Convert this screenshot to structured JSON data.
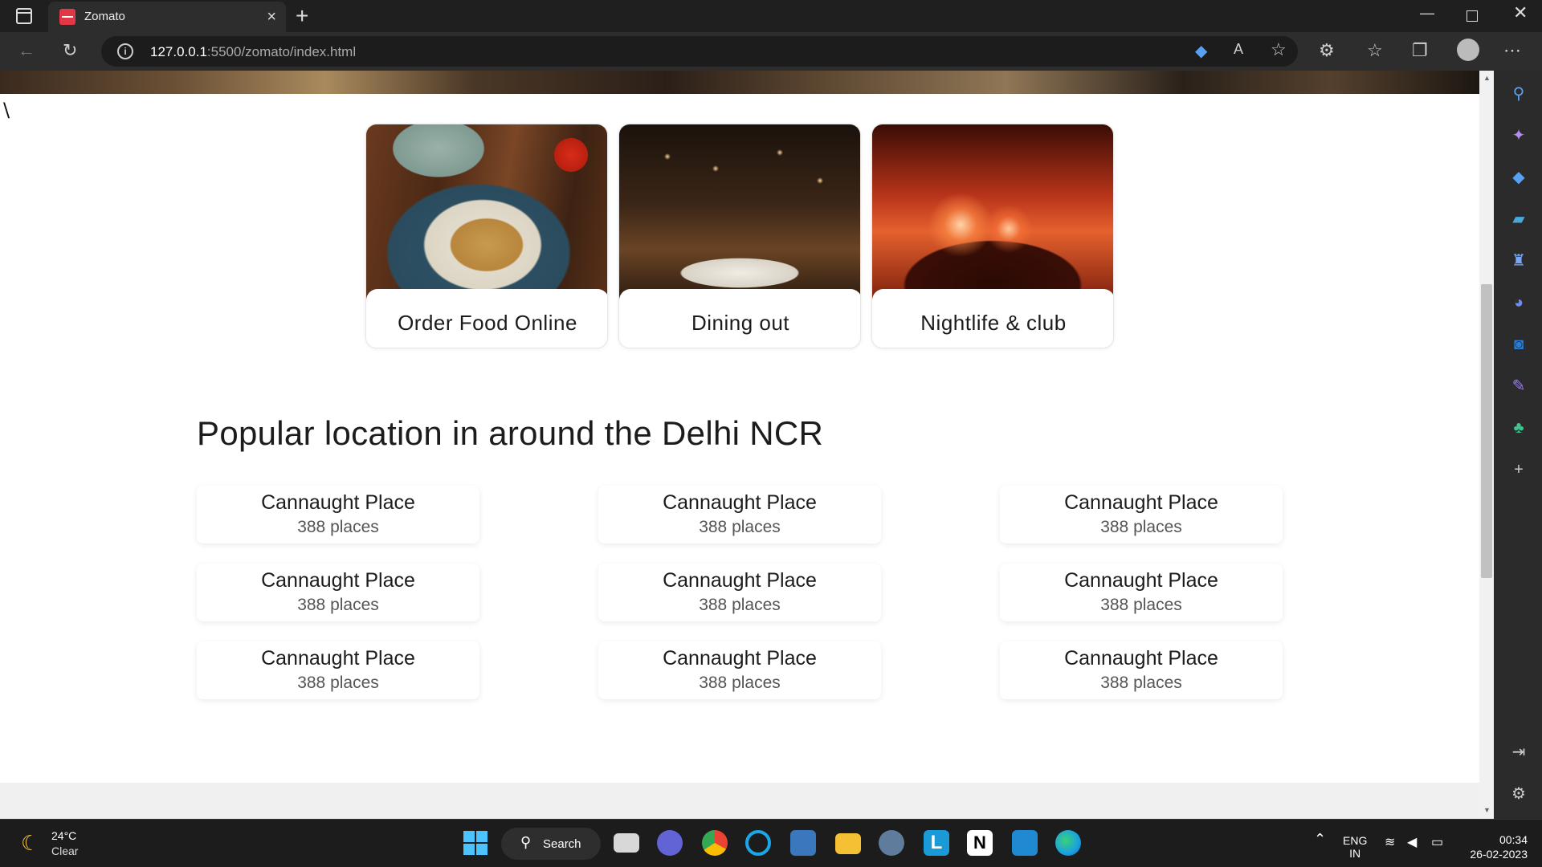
{
  "browser": {
    "tab_title": "Zomato",
    "url_host": "127.0.0.1",
    "url_rest": ":5500/zomato/index.html"
  },
  "page": {
    "stray_text": "\\",
    "categories": [
      {
        "label": "Order Food Online",
        "icon": "food-photo"
      },
      {
        "label": "Dining out",
        "icon": "restaurant-photo"
      },
      {
        "label": "Nightlife & club",
        "icon": "nightclub-photo"
      }
    ],
    "section_title": "Popular location in around the Delhi NCR",
    "locations": [
      {
        "name": "Cannaught Place",
        "count": "388 places"
      },
      {
        "name": "Cannaught Place",
        "count": "388 places"
      },
      {
        "name": "Cannaught Place",
        "count": "388 places"
      },
      {
        "name": "Cannaught Place",
        "count": "388 places"
      },
      {
        "name": "Cannaught Place",
        "count": "388 places"
      },
      {
        "name": "Cannaught Place",
        "count": "388 places"
      },
      {
        "name": "Cannaught Place",
        "count": "388 places"
      },
      {
        "name": "Cannaught Place",
        "count": "388 places"
      },
      {
        "name": "Cannaught Place",
        "count": "388 places"
      }
    ]
  },
  "taskbar": {
    "weather_temp": "24°C",
    "weather_cond": "Clear",
    "search_label": "Search",
    "lang_top": "ENG",
    "lang_bottom": "IN",
    "time": "00:34",
    "date": "26-02-2023"
  },
  "colors": {
    "brand": "#e23744",
    "text": "#1c1c1c"
  }
}
